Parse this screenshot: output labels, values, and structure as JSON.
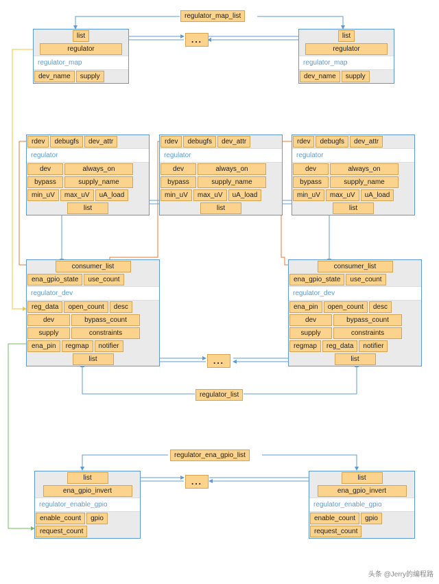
{
  "top": {
    "list_label": "regulator_map_list",
    "map_box": {
      "row1": [
        "list"
      ],
      "row2": [
        "regulator"
      ],
      "type": "regulator_map",
      "row3": [
        "dev_name",
        "supply"
      ]
    },
    "ellipsis": "..."
  },
  "mid": {
    "regulator_box": {
      "row1": [
        "rdev",
        "debugfs",
        "dev_attr"
      ],
      "type": "regulator",
      "row2": [
        "dev",
        "always_on"
      ],
      "row3": [
        "bypass",
        "supply_name"
      ],
      "row4": [
        "min_uV",
        "max_uV",
        "uA_load"
      ],
      "row5": [
        "list"
      ]
    },
    "dev_box_left": {
      "row1": [
        "consumer_list"
      ],
      "row2": [
        "ena_gpio_state",
        "use_count"
      ],
      "type": "regulator_dev",
      "row3": [
        "reg_data",
        "open_count",
        "desc"
      ],
      "row4": [
        "dev",
        "bypass_count"
      ],
      "row5": [
        "supply",
        "constraints"
      ],
      "row6": [
        "ena_pin",
        "regmap",
        "notifier"
      ],
      "row7": [
        "list"
      ]
    },
    "dev_box_right": {
      "row1": [
        "consumer_list"
      ],
      "row2": [
        "ena_gpio_state",
        "use_count"
      ],
      "type": "regulator_dev",
      "row3": [
        "ena_pin",
        "open_count",
        "desc"
      ],
      "row4": [
        "dev",
        "bypass_count"
      ],
      "row5": [
        "supply",
        "constraints"
      ],
      "row6": [
        "regmap",
        "reg_data",
        "notifier"
      ],
      "row7": [
        "list"
      ]
    },
    "list_label": "regulator_list",
    "ellipsis": "..."
  },
  "bottom": {
    "list_label": "regulator_ena_gpio_list",
    "gpio_box": {
      "row1": [
        "list"
      ],
      "row2": [
        "ena_gpio_invert"
      ],
      "type": "regulator_enable_gpio",
      "row3": [
        "enable_count",
        "gpio"
      ],
      "row4": [
        "request_count"
      ]
    },
    "ellipsis": "..."
  },
  "watermark": "头条 @Jerry的编程路"
}
